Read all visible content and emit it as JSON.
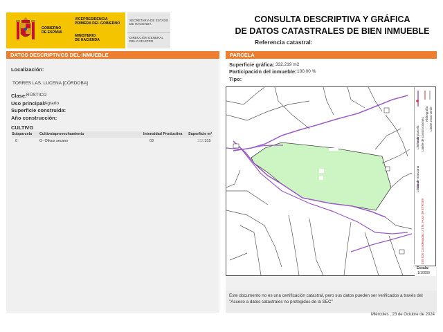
{
  "header": {
    "gov_label": "GOBIERNO\nDE ESPAÑA",
    "vp_label": "VICEPRESIDENCIA\nPRIMERA DEL GOBIERNO",
    "ministry_label": "MINISTERIO\nDE HACIENDA",
    "secretaria_label": "SECRETARÍA DE ESTADO\nDE HACIENDA",
    "direccion_label": "DIRECCIÓN GENERAL\nDEL CATASTRO",
    "title_line1": "CONSULTA DESCRIPTIVA Y GRÁFICA",
    "title_line2": "DE DATOS CATASTRALES DE BIEN INMUEBLE",
    "ref_catastral_label": "Referencia catastral:"
  },
  "left": {
    "section_title": "DATOS DESCRIPTIVOS DEL INMUEBLE",
    "localizacion_label": "Localización:",
    "localizacion_value": "TORRES LAS. LUCENA [CÓRDOBA]",
    "clase_label": "Clase:",
    "clase_value": "RÚSTICO",
    "uso_label": "Uso principal:",
    "uso_value": "Agrario",
    "superficie_label": "Superficie construida:",
    "anio_label": "Año construcción:",
    "cultivo_title": "CULTIVO",
    "cultivo_headers": {
      "subparcela": "Subparcela",
      "cultivo": "Cultivo/aprovechamiento",
      "intensidad": "Intensidad Productiva",
      "superficie": "Superficie m²"
    },
    "cultivo_row": {
      "subparcela": "0",
      "cultivo": "O- Olivos secano",
      "intensidad": "03",
      "superficie_a": "332",
      "superficie_b": ".315"
    }
  },
  "right": {
    "section_title": "PARCELA",
    "sup_grafica_label": "Superficie gráfica:",
    "sup_grafica_value": "332.219 m2",
    "participacion_label": "Participación del inmueble:",
    "participacion_value": "100,00 %",
    "tipo_label": "Tipo:",
    "legend": {
      "hidrografia": "Hidrografía",
      "limite_parcela": "Límite de parcela",
      "limite_construcciones": "Límite de construcciones",
      "limite_manzana": "Límite de manzana",
      "limite_zona_verde": "Límite zona verde",
      "coordinates": "359.926 Coordenadas U.T.M. Huso 30 ETRS89"
    },
    "escala_label": "Escala:",
    "escala_value": "1/10000",
    "note": "Este documento no es una certificación catastral, pero sus datos pueden ser verificados a través del \"Acceso a datos catastrales no protegidos de la SEC\""
  },
  "footer": {
    "date": "Miércoles , 23 de Octubre de 2024"
  },
  "colors": {
    "accent_orange": "#ee7e2f",
    "gov_yellow": "#f5c400",
    "parcel_fill": "#cdf5c4",
    "boundary_purple": "#9c5cc7"
  }
}
